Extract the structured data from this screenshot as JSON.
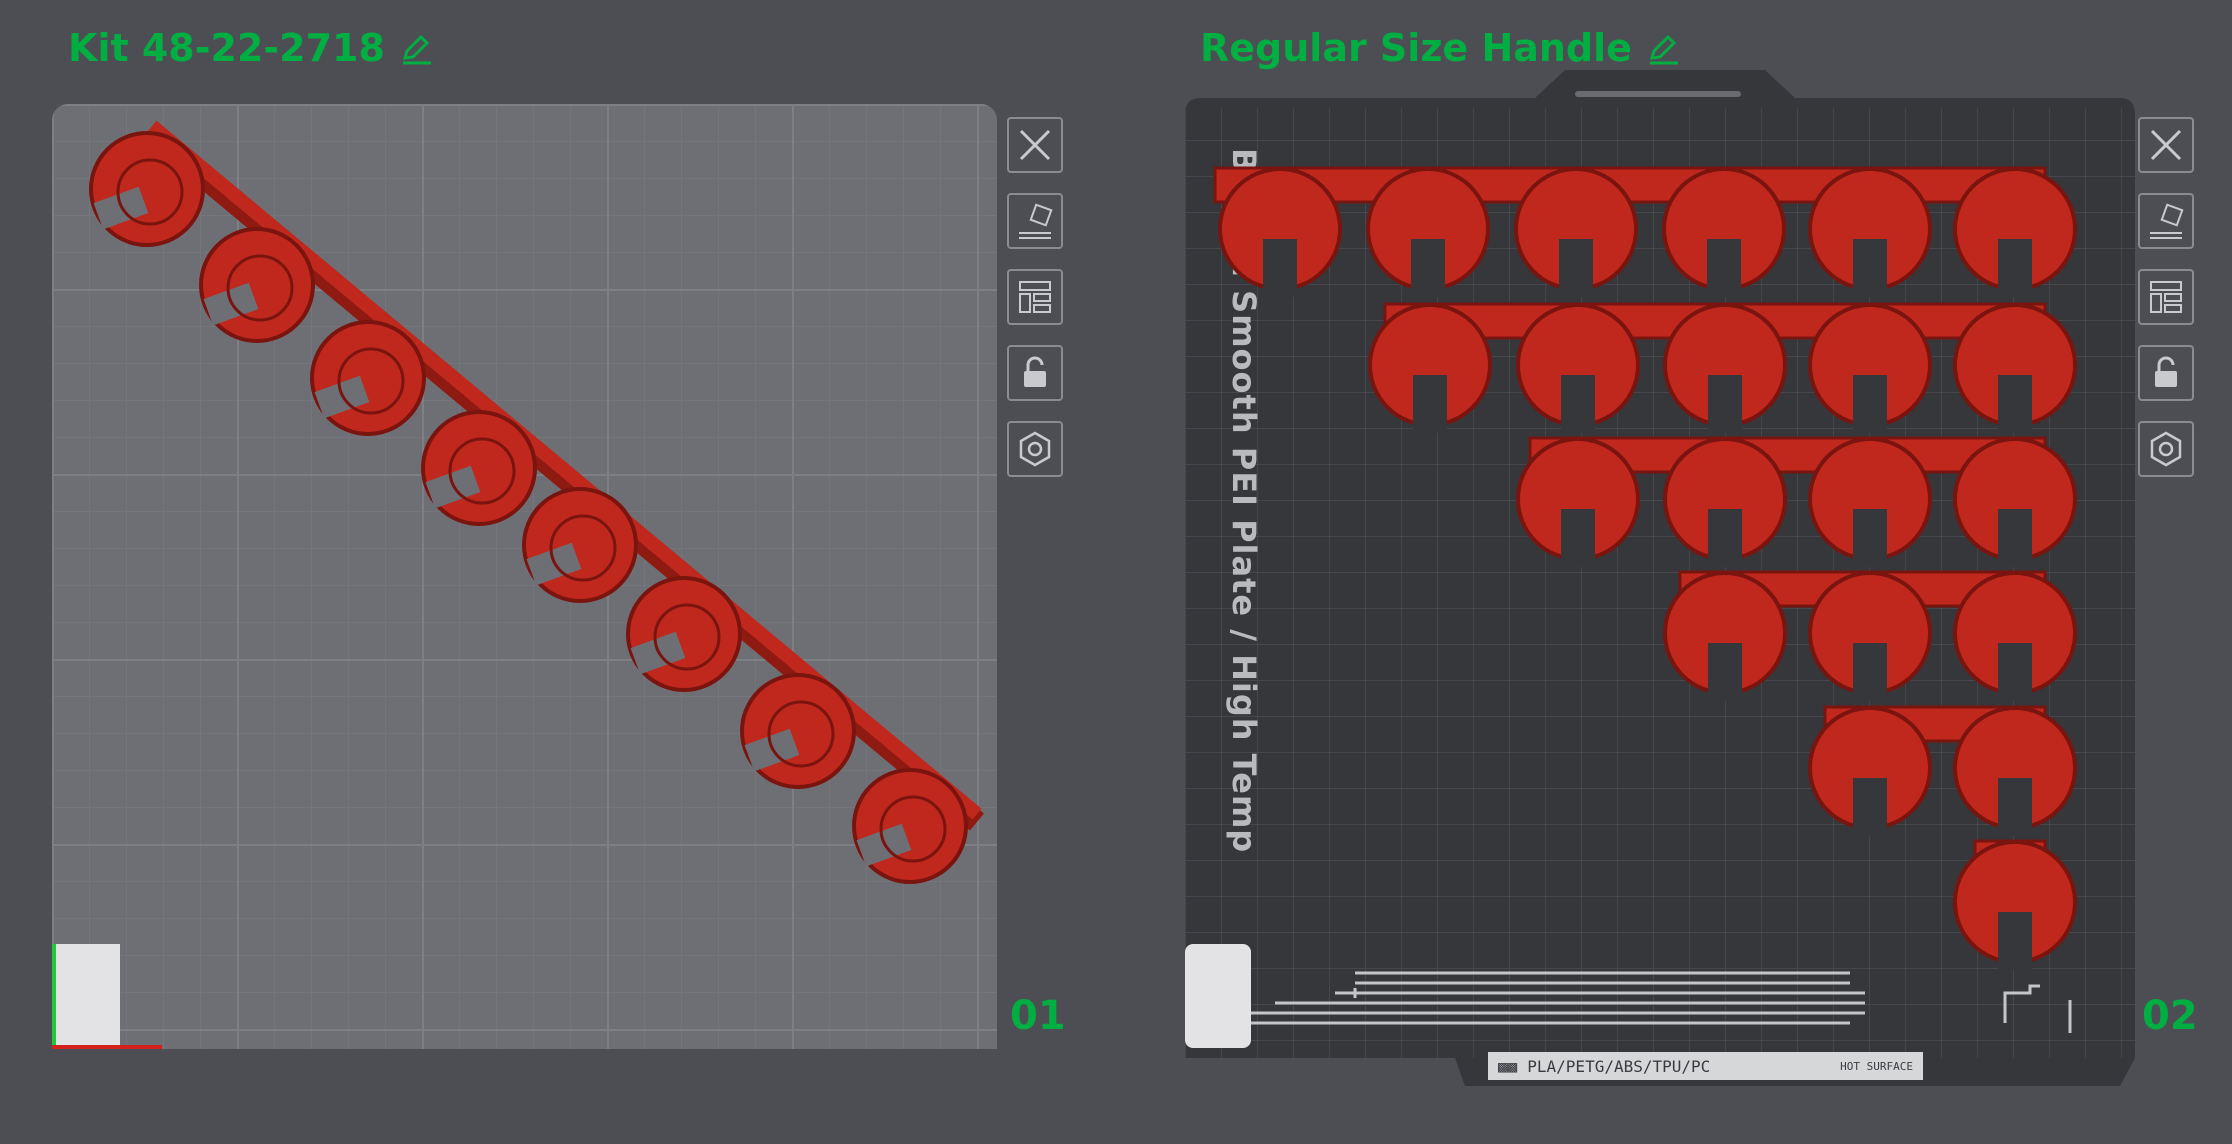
{
  "colors": {
    "accent": "#00ae42",
    "part": "#c0281d",
    "plate1": "#6e6f75",
    "plate2": "#36373b"
  },
  "plates": [
    {
      "title": "Kit 48-22-2718",
      "number": "01"
    },
    {
      "title": "Regular Size Handle",
      "number": "02",
      "plate_type": "Bambu Smooth PEI Plate / High Temp Plate"
    }
  ],
  "plate_label_strip": {
    "materials": "PLA/PETG/ABS/TPU/PC",
    "warning": "HOT SURFACE"
  },
  "icons": [
    "close-icon",
    "auto-orient-icon",
    "arrange-icon",
    "lock-icon",
    "settings-icon",
    "edit-icon"
  ]
}
